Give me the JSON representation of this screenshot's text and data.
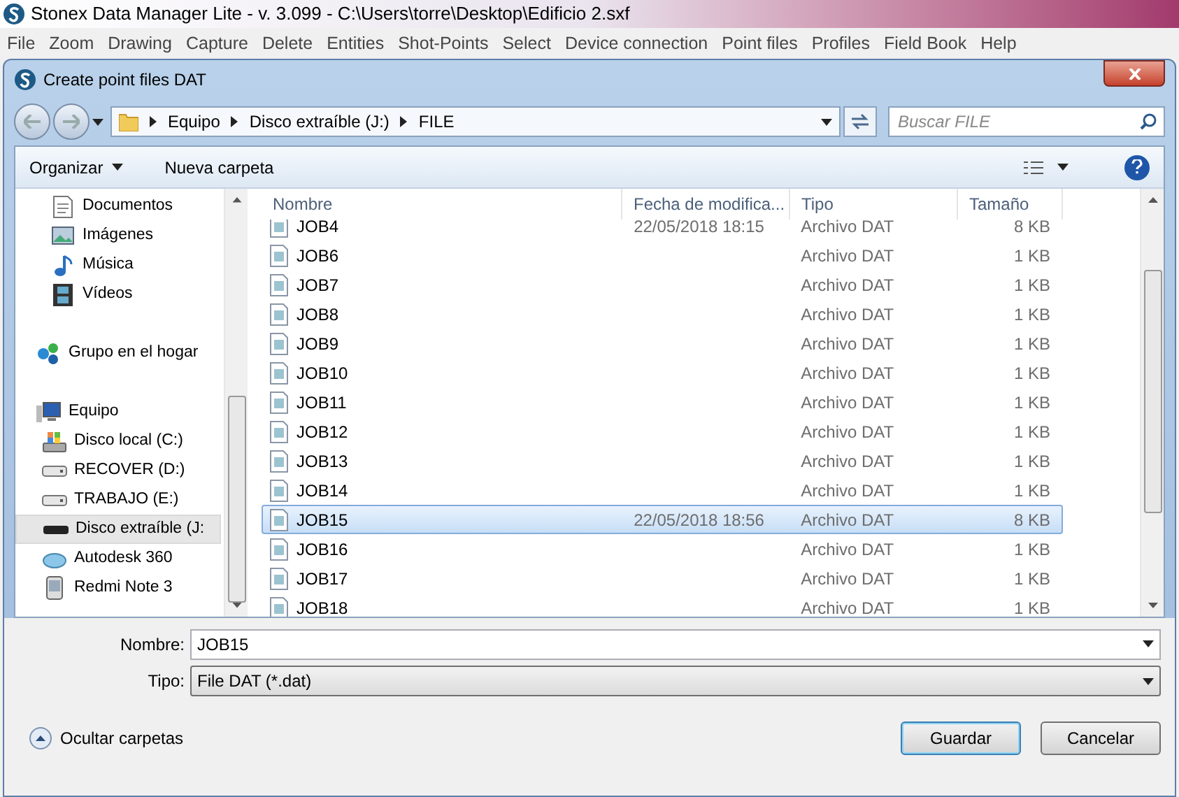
{
  "app": {
    "title": "Stonex Data Manager Lite - v. 3.099 - C:\\Users\\torre\\Desktop\\Edificio 2.sxf"
  },
  "menu": [
    "File",
    "Zoom",
    "Drawing",
    "Capture",
    "Delete",
    "Entities",
    "Shot-Points",
    "Select",
    "Device connection",
    "Point files",
    "Profiles",
    "Field Book",
    "Help"
  ],
  "dialog": {
    "title": "Create point files DAT",
    "breadcrumb": [
      "Equipo",
      "Disco extraíble (J:)",
      "FILE"
    ],
    "search": {
      "placeholder": "Buscar FILE"
    },
    "toolbar": [
      "Organizar",
      "Nueva carpeta"
    ],
    "sidebar": {
      "libraries": [
        {
          "label": "Documentos",
          "kind": "document",
          "selected": false
        },
        {
          "label": "Imágenes",
          "kind": "image",
          "selected": false
        },
        {
          "label": "Música",
          "kind": "music",
          "selected": false
        },
        {
          "label": "Vídeos",
          "kind": "video",
          "selected": false
        }
      ],
      "groups": [
        {
          "label": "Grupo en el hogar",
          "kind": "homegroup",
          "selected": false
        },
        {
          "label": "Equipo",
          "kind": "computer",
          "selected": false,
          "children": [
            {
              "label": "Disco local (C:)",
              "kind": "system-disk",
              "selected": false
            },
            {
              "label": "RECOVER (D:)",
              "kind": "disk",
              "selected": false
            },
            {
              "label": "TRABAJO (E:)",
              "kind": "disk",
              "selected": false
            },
            {
              "label": "Disco extraíble (J:",
              "kind": "removable",
              "selected": true
            },
            {
              "label": "Autodesk 360",
              "kind": "cloud",
              "selected": false
            },
            {
              "label": "Redmi Note 3",
              "kind": "phone",
              "selected": false
            }
          ]
        }
      ]
    },
    "columns": [
      "Nombre",
      "Fecha de modifica...",
      "Tipo",
      "Tamaño"
    ],
    "rows": [
      {
        "name": "JOB4",
        "date": "22/05/2018 18:15",
        "type": "Archivo DAT",
        "size": "8 KB",
        "selected": false
      },
      {
        "name": "JOB6",
        "type": "Archivo DAT",
        "size": "1 KB",
        "selected": false
      },
      {
        "name": "JOB7",
        "type": "Archivo DAT",
        "size": "1 KB",
        "selected": false
      },
      {
        "name": "JOB8",
        "type": "Archivo DAT",
        "size": "1 KB",
        "selected": false
      },
      {
        "name": "JOB9",
        "type": "Archivo DAT",
        "size": "1 KB",
        "selected": false
      },
      {
        "name": "JOB10",
        "type": "Archivo DAT",
        "size": "1 KB",
        "selected": false
      },
      {
        "name": "JOB11",
        "type": "Archivo DAT",
        "size": "1 KB",
        "selected": false
      },
      {
        "name": "JOB12",
        "type": "Archivo DAT",
        "size": "1 KB",
        "selected": false
      },
      {
        "name": "JOB13",
        "type": "Archivo DAT",
        "size": "1 KB",
        "selected": false
      },
      {
        "name": "JOB14",
        "type": "Archivo DAT",
        "size": "1 KB",
        "selected": false
      },
      {
        "name": "JOB15",
        "date": "22/05/2018 18:56",
        "type": "Archivo DAT",
        "size": "8 KB",
        "selected": true
      },
      {
        "name": "JOB16",
        "type": "Archivo DAT",
        "size": "1 KB",
        "selected": false
      },
      {
        "name": "JOB17",
        "type": "Archivo DAT",
        "size": "1 KB",
        "selected": false
      },
      {
        "name": "JOB18",
        "type": "Archivo DAT",
        "size": "1 KB",
        "selected": false
      }
    ],
    "filename": {
      "label": "Nombre:",
      "value": "JOB15"
    },
    "filetype": {
      "label": "Tipo:",
      "value": "File DAT (*.dat)"
    },
    "hide_folders": "Ocultar carpetas",
    "buttons": [
      "Guardar",
      "Cancelar"
    ]
  }
}
